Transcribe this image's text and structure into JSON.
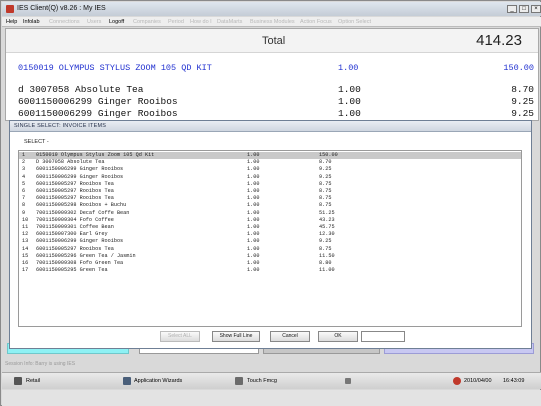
{
  "window": {
    "title": "IES Client(Q) v8.26 : My IES"
  },
  "menu": [
    {
      "label": "Help",
      "dim": false
    },
    {
      "label": "Infolab",
      "dim": false
    },
    {
      "label": "Connections",
      "dim": true
    },
    {
      "label": "Users",
      "dim": true
    },
    {
      "label": "Logoff",
      "dim": false
    },
    {
      "label": "Companies",
      "dim": true
    },
    {
      "label": "Period",
      "dim": true
    },
    {
      "label": "How do I",
      "dim": true
    },
    {
      "label": "DataMarts",
      "dim": true
    },
    {
      "label": "Business Modules",
      "dim": true
    },
    {
      "label": "Action Focus",
      "dim": true
    },
    {
      "label": "Option Select",
      "dim": true
    }
  ],
  "pos": {
    "total_label": "Total",
    "total_value": "414.23",
    "lines": [
      {
        "desc": "0150019 OLYMPUS STYLUS ZOOM 105 QD KIT",
        "qty": "1.00",
        "amt": "150.00",
        "selected": true
      },
      {
        "desc": "d 3007058 Absolute Tea",
        "qty": "1.00",
        "amt": "8.70",
        "selected": false
      },
      {
        "desc": "6001150006299 Ginger Rooibos",
        "qty": "1.00",
        "amt": "9.25",
        "selected": false
      },
      {
        "desc": "6001150006299 Ginger Rooibos",
        "qty": "1.00",
        "amt": "9.25",
        "selected": false
      }
    ]
  },
  "dialog": {
    "title": "SINGLE SELECT: INVOICE ITEMS",
    "select_label": "SELECT -",
    "rows": [
      {
        "n": "1",
        "desc": "0150019 Olympus Stylus Zoom 105 Qd Kit",
        "qty": "1.00",
        "amt": "150.00"
      },
      {
        "n": "2",
        "desc": "D 3007058 Absolute Tea",
        "qty": "1.00",
        "amt": "8.70"
      },
      {
        "n": "3",
        "desc": "6001150006299 Ginger Rooibos",
        "qty": "1.00",
        "amt": "9.25"
      },
      {
        "n": "4",
        "desc": "6001150006299 Ginger Rooibos",
        "qty": "1.00",
        "amt": "9.25"
      },
      {
        "n": "5",
        "desc": "6001150005297 Rooibos Tea",
        "qty": "1.00",
        "amt": "8.75"
      },
      {
        "n": "6",
        "desc": "6001150005297 Rooibos Tea",
        "qty": "1.00",
        "amt": "8.75"
      },
      {
        "n": "7",
        "desc": "6001150005297 Rooibos Tea",
        "qty": "1.00",
        "amt": "8.75"
      },
      {
        "n": "8",
        "desc": "6001150005298 Rooibos + Buchu",
        "qty": "1.00",
        "amt": "8.75"
      },
      {
        "n": "9",
        "desc": "7001150909302 Decaf Coffe Bean",
        "qty": "1.00",
        "amt": "51.25"
      },
      {
        "n": "10",
        "desc": "7001150909304 Fofo Coffee",
        "qty": "1.00",
        "amt": "43.23"
      },
      {
        "n": "11",
        "desc": "7001150909301 Coffee Bean",
        "qty": "1.00",
        "amt": "45.75"
      },
      {
        "n": "12",
        "desc": "6001150007300 Earl Grey",
        "qty": "1.00",
        "amt": "12.30"
      },
      {
        "n": "13",
        "desc": "6001150006299 Ginger Rooibos",
        "qty": "1.00",
        "amt": "9.25"
      },
      {
        "n": "14",
        "desc": "6001150005297 Rooibos Tea",
        "qty": "1.00",
        "amt": "8.75"
      },
      {
        "n": "15",
        "desc": "6001150005296 Green Tea / Jasmin",
        "qty": "1.00",
        "amt": "11.50"
      },
      {
        "n": "16",
        "desc": "7001150909308 Fofo Green Tea",
        "qty": "1.00",
        "amt": "8.80"
      },
      {
        "n": "17",
        "desc": "6001150005295 Green Tea",
        "qty": "1.00",
        "amt": "11.00"
      }
    ],
    "buttons": {
      "select_all": "Select ALL",
      "show_full_line": "Show Full Line",
      "cancel": "Cancel",
      "ok": "OK"
    },
    "input_value": ""
  },
  "status": {
    "message": "Session Info: Barry is using IES"
  },
  "taskbar": {
    "items": [
      {
        "label": "Retail",
        "icon": "retail-icon"
      },
      {
        "label": "Application Wizards",
        "icon": "wizards-icon"
      },
      {
        "label": "Touch Fmcg",
        "icon": "touch-icon"
      }
    ],
    "date": "2010/04/00",
    "time": "16:43:09"
  },
  "colors": {
    "selected_line": "#2030d0",
    "cyan_field": "#8ef1f4",
    "lavender_field": "#c8c8f2",
    "clock_icon": "#c0392b"
  }
}
